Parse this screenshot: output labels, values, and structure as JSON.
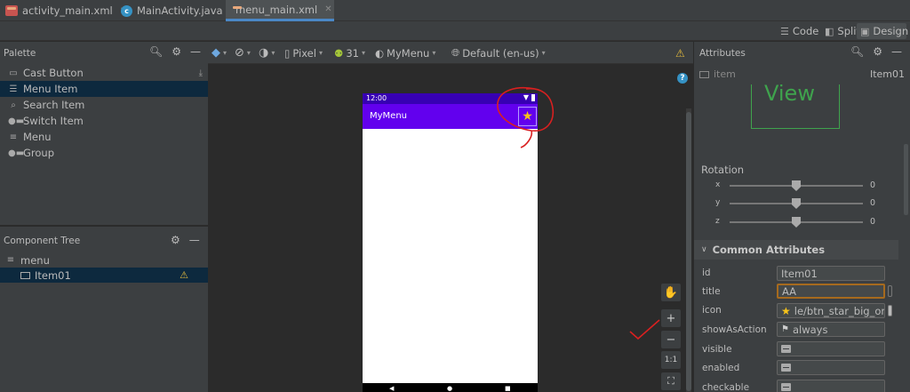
{
  "tabs": [
    {
      "label": "activity_main.xml",
      "icon": "xml-file-icon",
      "active": false
    },
    {
      "label": "MainActivity.java",
      "icon": "java-class-icon",
      "active": false
    },
    {
      "label": "menu_main.xml",
      "icon": "xml-file-icon",
      "active": true
    }
  ],
  "view_modes": {
    "code": "Code",
    "split": "Split",
    "design": "Design",
    "active": "Design"
  },
  "palette": {
    "title": "Palette",
    "items": [
      {
        "label": "Cast Button",
        "icon": "cast-icon"
      },
      {
        "label": "Menu Item",
        "icon": "list-icon",
        "selected": true
      },
      {
        "label": "Search Item",
        "icon": "search-icon"
      },
      {
        "label": "Switch Item",
        "icon": "switch-icon"
      },
      {
        "label": "Menu",
        "icon": "menu-icon"
      },
      {
        "label": "Group",
        "icon": "group-icon"
      }
    ]
  },
  "component_tree": {
    "title": "Component Tree",
    "root": "menu",
    "child": "Item01"
  },
  "design_toolbar": {
    "device": "Pixel",
    "api": "31",
    "theme": "MyMenu",
    "locale": "Default (en-us)"
  },
  "preview": {
    "time": "12:00",
    "app_title": "MyMenu",
    "status_color": "#3700b3",
    "appbar_color": "#6200ee"
  },
  "zoom_controls": {
    "hand": "pan-hand-icon",
    "plus": "+",
    "minus": "−",
    "one_to_one": "1:1"
  },
  "attributes": {
    "title": "Attributes",
    "component_label": "item",
    "component_id": "Item01",
    "preview_text": "View",
    "rotation": {
      "title": "Rotation",
      "axes": [
        {
          "axis": "x",
          "value": "0"
        },
        {
          "axis": "y",
          "value": "0"
        },
        {
          "axis": "z",
          "value": "0"
        }
      ]
    },
    "common_title": "Common Attributes",
    "fields": [
      {
        "name": "id",
        "value": "Item01"
      },
      {
        "name": "title",
        "value": "AA"
      },
      {
        "name": "icon",
        "value": "le/btn_star_big_on"
      },
      {
        "name": "showAsAction",
        "value": "always"
      },
      {
        "name": "visible",
        "value": ""
      },
      {
        "name": "enabled",
        "value": ""
      },
      {
        "name": "checkable",
        "value": ""
      }
    ]
  }
}
